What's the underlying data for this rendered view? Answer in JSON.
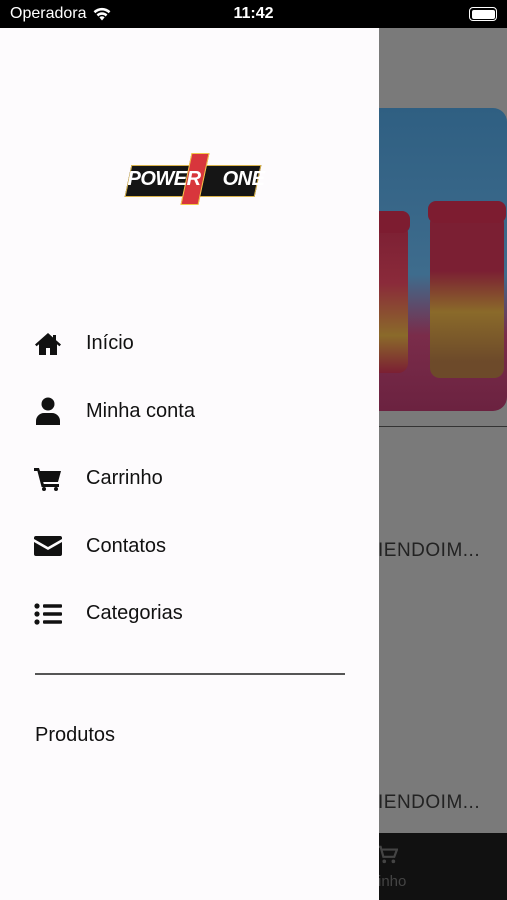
{
  "status_bar": {
    "carrier": "Operadora",
    "time": "11:42"
  },
  "background": {
    "product_title_1": "IENDOIM...",
    "product_title_2": "IENDOIM...",
    "tab_label": "inho"
  },
  "drawer": {
    "logo_text_left": "POWER",
    "logo_text_right": "ONE",
    "menu": [
      {
        "label": "Início",
        "icon": "home-icon"
      },
      {
        "label": "Minha conta",
        "icon": "user-icon"
      },
      {
        "label": "Carrinho",
        "icon": "cart-icon"
      },
      {
        "label": "Contatos",
        "icon": "envelope-icon"
      },
      {
        "label": "Categorias",
        "icon": "list-icon"
      }
    ],
    "section_title": "Produtos"
  }
}
